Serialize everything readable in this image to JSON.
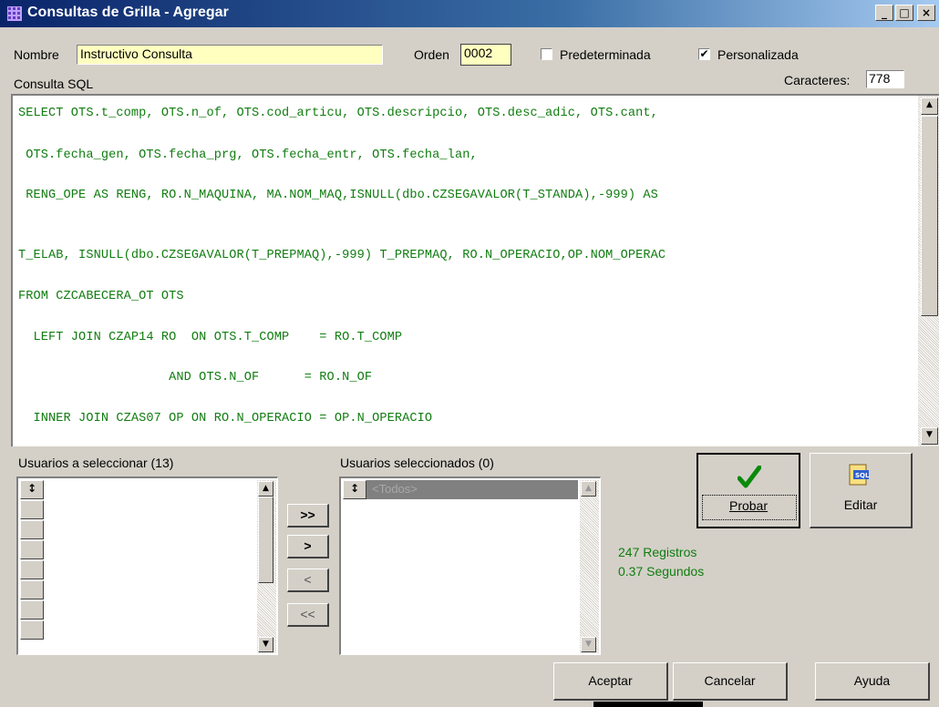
{
  "window": {
    "title": "Consultas de Grilla - Agregar",
    "controls": [
      "_",
      "□",
      "×"
    ]
  },
  "form": {
    "nombre_label": "Nombre",
    "nombre_value": "Instructivo Consulta",
    "orden_label": "Orden",
    "orden_value": "0002",
    "predeterminada_label": "Predeterminada",
    "predeterminada_checked": false,
    "personalizada_label": "Personalizada",
    "personalizada_checked": true,
    "check_mark": "✔",
    "consulta_label": "Consulta SQL",
    "caracteres_label": "Caracteres:",
    "caracteres_value": "778"
  },
  "sql_lines": [
    "SELECT OTS.t_comp, OTS.n_of, OTS.cod_articu, OTS.descripcio, OTS.desc_adic, OTS.cant,",
    " OTS.fecha_gen, OTS.fecha_prg, OTS.fecha_entr, OTS.fecha_lan,",
    " RENG_OPE AS RENG, RO.N_MAQUINA, MA.NOM_MAQ,ISNULL(dbo.CZSEGAVALOR(T_STANDA),-999) AS",
    "T_ELAB, ISNULL(dbo.CZSEGAVALOR(T_PREPMAQ),-999) T_PREPMAQ, RO.N_OPERACIO,OP.NOM_OPERAC",
    "FROM CZCABECERA_OT OTS",
    "  LEFT JOIN CZAP14 RO  ON OTS.T_COMP    = RO.T_COMP",
    "                    AND OTS.N_OF      = RO.N_OF",
    "  INNER JOIN CZAS07 OP ON RO.N_OPERACIO = OP.N_OPERACIO"
  ],
  "usuarios": {
    "a_seleccionar_label": "Usuarios a seleccionar (13)",
    "seleccionados_label": "Usuarios seleccionados (0)",
    "todos_item": "<Todos>"
  },
  "transfer_buttons": {
    "all_right": ">>",
    "one_right": ">",
    "one_left": "<",
    "all_left": "<<"
  },
  "test": {
    "probar_label": "Probar",
    "editar_label": "Editar",
    "registros": "247 Registros",
    "segundos": "0.37 Segundos"
  },
  "footer": {
    "aceptar": "Aceptar",
    "cancelar": "Cancelar",
    "ayuda": "Ayuda"
  },
  "colors": {
    "title_bar": "#0a246a",
    "sql_text": "#107c10",
    "nombre_bg": "#ffffc0"
  },
  "icons": {
    "app": "grid-icon",
    "probar": "checkmark-icon",
    "editar": "sql-edit-icon"
  }
}
